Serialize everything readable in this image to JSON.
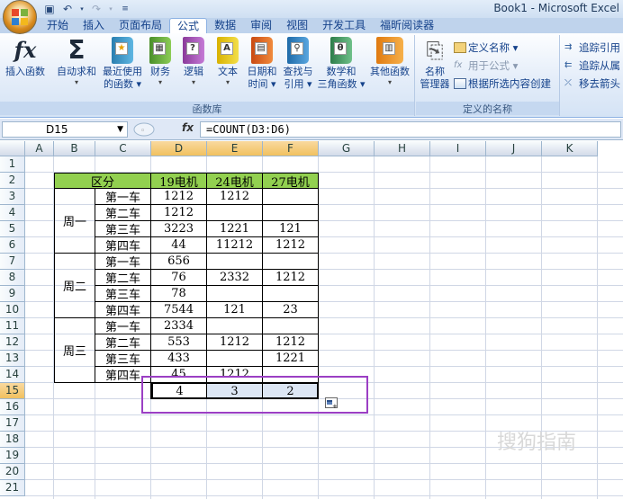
{
  "window": {
    "title": "Book1 - Microsoft Excel"
  },
  "tabs": [
    "开始",
    "插入",
    "页面布局",
    "公式",
    "数据",
    "审阅",
    "视图",
    "开发工具",
    "福昕阅读器"
  ],
  "active_tab": "公式",
  "ribbon": {
    "function_library": {
      "label": "函数库",
      "buttons": [
        {
          "label": "插入函数",
          "sub": ""
        },
        {
          "label": "自动求和",
          "sub": "▾"
        },
        {
          "label": "最近使用的函数",
          "line1": "最近使用",
          "line2": "的函数 ▾"
        },
        {
          "label": "财务",
          "sub": "▾"
        },
        {
          "label": "逻辑",
          "sub": "▾"
        },
        {
          "label": "文本",
          "sub": "▾"
        },
        {
          "label": "日期和时间",
          "line1": "日期和",
          "line2": "时间 ▾"
        },
        {
          "label": "查找与引用",
          "line1": "查找与",
          "line2": "引用 ▾"
        },
        {
          "label": "数学和三角函数",
          "line1": "数学和",
          "line2": "三角函数 ▾"
        },
        {
          "label": "其他函数",
          "sub": "▾"
        }
      ]
    },
    "defined_names": {
      "label": "定义的名称",
      "name_manager": {
        "line1": "名称",
        "line2": "管理器"
      },
      "define_name": "定义名称 ▾",
      "use_in_formula": "用于公式 ▾",
      "create_from_selection": "根据所选内容创建"
    },
    "formula_auditing": {
      "trace_precedents": "追踪引用",
      "trace_dependents": "追踪从属",
      "remove_arrows": "移去箭头"
    }
  },
  "formula_bar": {
    "name_box": "D15",
    "fx": "fx",
    "formula": "=COUNT(D3:D6)"
  },
  "columns": [
    "A",
    "B",
    "C",
    "D",
    "E",
    "F",
    "G",
    "H",
    "I",
    "J",
    "K"
  ],
  "rows": [
    "1",
    "2",
    "3",
    "4",
    "5",
    "6",
    "7",
    "8",
    "9",
    "10",
    "11",
    "12",
    "13",
    "14",
    "15",
    "16",
    "17",
    "18",
    "19",
    "20",
    "21"
  ],
  "table": {
    "header": {
      "group": "区分",
      "c1": "19电机",
      "c2": "24电机",
      "c3": "27电机"
    },
    "groups": [
      {
        "name": "周一",
        "rows": [
          {
            "car": "第一车",
            "v1": "1212",
            "v2": "1212",
            "v3": ""
          },
          {
            "car": "第二车",
            "v1": "1212",
            "v2": "",
            "v3": ""
          },
          {
            "car": "第三车",
            "v1": "3223",
            "v2": "1221",
            "v3": "121"
          },
          {
            "car": "第四车",
            "v1": "44",
            "v2": "11212",
            "v3": "1212"
          }
        ]
      },
      {
        "name": "周二",
        "rows": [
          {
            "car": "第一车",
            "v1": "656",
            "v2": "",
            "v3": ""
          },
          {
            "car": "第二车",
            "v1": "76",
            "v2": "2332",
            "v3": "1212"
          },
          {
            "car": "第三车",
            "v1": "78",
            "v2": "",
            "v3": ""
          },
          {
            "car": "第四车",
            "v1": "7544",
            "v2": "121",
            "v3": "23"
          }
        ]
      },
      {
        "name": "周三",
        "rows": [
          {
            "car": "第一车",
            "v1": "2334",
            "v2": "",
            "v3": ""
          },
          {
            "car": "第二车",
            "v1": "553",
            "v2": "1212",
            "v3": "1212"
          },
          {
            "car": "第三车",
            "v1": "433",
            "v2": "",
            "v3": "1221"
          },
          {
            "car": "第四车",
            "v1": "45",
            "v2": "1212",
            "v3": ""
          }
        ]
      }
    ],
    "results": {
      "d": "4",
      "e": "3",
      "f": "2"
    }
  },
  "watermark": "搜狗指南",
  "colors": {
    "header_fill": "#92d050",
    "highlight_border": "#9b3fc4",
    "selected_header": "#f1c15f"
  }
}
